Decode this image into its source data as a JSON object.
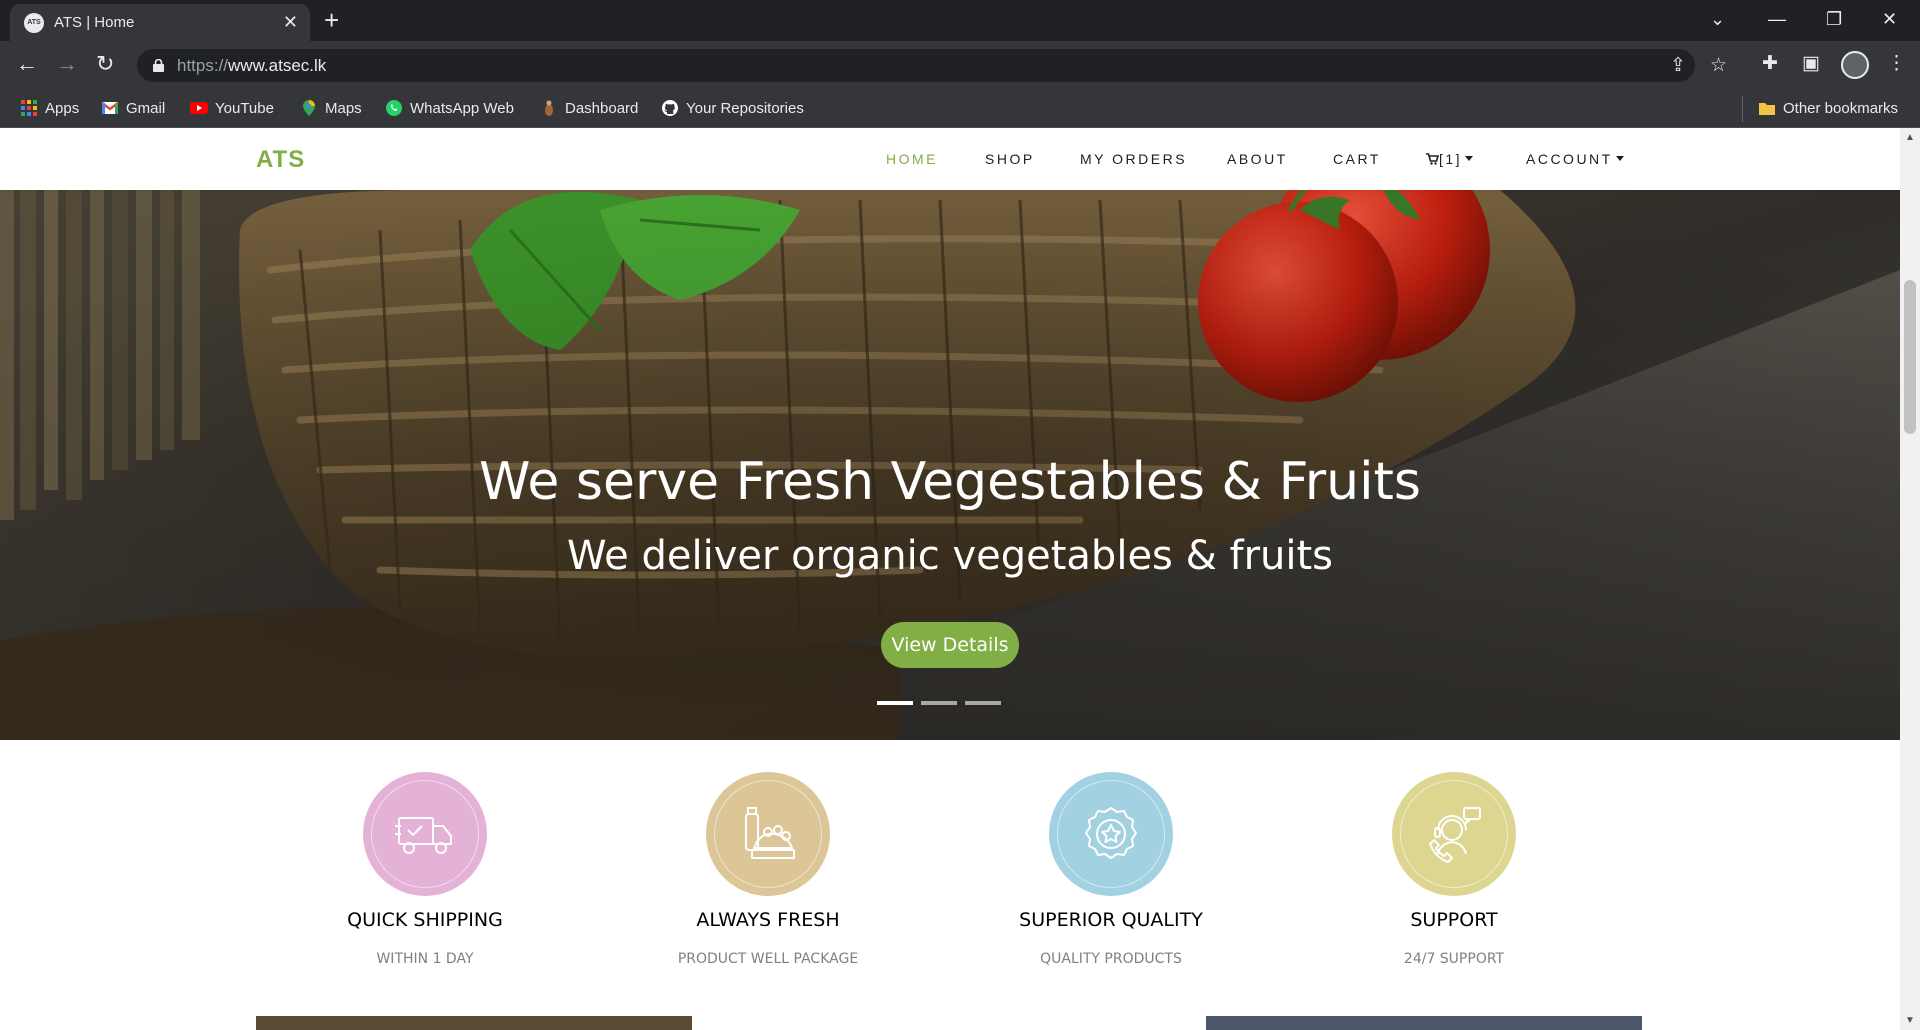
{
  "browser": {
    "tab": {
      "title": "ATS | Home",
      "favicon_text": "ATS"
    },
    "url": {
      "scheme": "https://",
      "host": "www.atsec.lk"
    },
    "bookmarks": [
      {
        "label": "Apps",
        "icon": "apps-grid-icon"
      },
      {
        "label": "Gmail",
        "icon": "gmail-icon"
      },
      {
        "label": "YouTube",
        "icon": "youtube-icon"
      },
      {
        "label": "Maps",
        "icon": "maps-icon"
      },
      {
        "label": "WhatsApp Web",
        "icon": "whatsapp-icon"
      },
      {
        "label": "Dashboard",
        "icon": "dashboard-icon"
      },
      {
        "label": "Your Repositories",
        "icon": "github-icon"
      }
    ],
    "other_bookmarks": "Other bookmarks"
  },
  "site": {
    "brand": "ATS",
    "brand_color": "#82ae46",
    "nav": {
      "home": "HOME",
      "shop": "SHOP",
      "orders": "MY ORDERS",
      "about": "ABOUT",
      "cart": "CART",
      "cart_count": "[1]",
      "account": "ACCOUNT"
    }
  },
  "hero": {
    "title": "We serve Fresh Vegestables & Fruits",
    "subtitle": "We deliver organic vegetables & fruits",
    "button": "View Details",
    "active_slide": 1,
    "slide_count": 3
  },
  "features": [
    {
      "title": "QUICK SHIPPING",
      "subtitle": "WITHIN 1 DAY",
      "color": "#e4b2d6",
      "icon": "delivery-truck-icon"
    },
    {
      "title": "ALWAYS FRESH",
      "subtitle": "PRODUCT WELL PACKAGE",
      "color": "#dcc698",
      "icon": "fresh-produce-icon"
    },
    {
      "title": "SUPERIOR QUALITY",
      "subtitle": "QUALITY PRODUCTS",
      "color": "#a2d1e1",
      "icon": "quality-badge-icon"
    },
    {
      "title": "SUPPORT",
      "subtitle": "24/7 SUPPORT",
      "color": "#dcd691",
      "icon": "support-agent-icon"
    }
  ]
}
